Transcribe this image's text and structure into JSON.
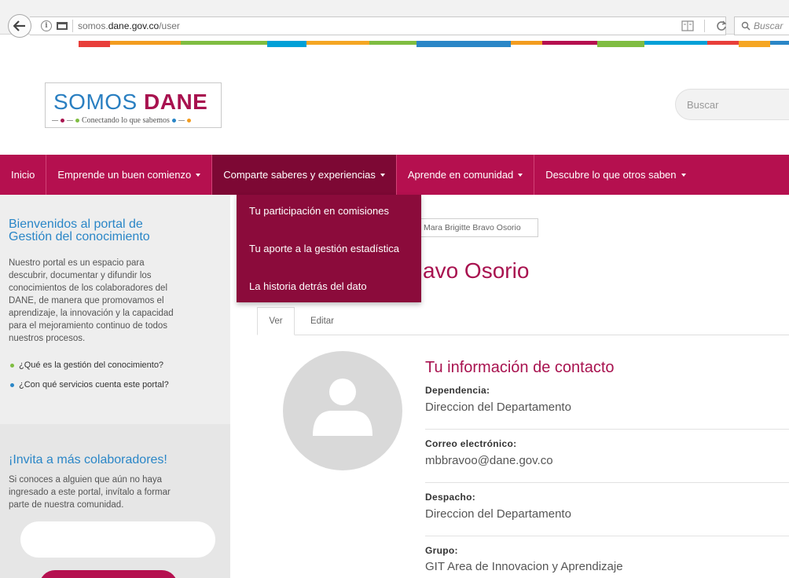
{
  "browser": {
    "url_prefix": "somos.",
    "url_domain": "dane.gov.co",
    "url_path": "/user",
    "search_placeholder": "Buscar"
  },
  "stripe_colors": [
    "#ffffff",
    "#e83e3a",
    "#f39c1f",
    "#7fbd41",
    "#00a0d7",
    "#f5a623",
    "#7fbd41",
    "#2a86c7",
    "#f39c1f",
    "#b5104f",
    "#7fbd41",
    "#00a0d7",
    "#e83e3a",
    "#f5a623",
    "#2a86c7"
  ],
  "logo": {
    "word1": "SOMOS",
    "word2": "DANE",
    "tagline": "Conectando lo que sabemos"
  },
  "site_search": {
    "placeholder": "Buscar"
  },
  "nav": {
    "items": [
      {
        "label": "Inicio",
        "caret": false
      },
      {
        "label": "Emprende un buen comienzo",
        "caret": true
      },
      {
        "label": "Comparte saberes y experiencias",
        "caret": true,
        "active": true
      },
      {
        "label": "Aprende en comunidad",
        "caret": true
      },
      {
        "label": "Descubre lo que otros saben",
        "caret": true
      }
    ]
  },
  "dropdown": {
    "items": [
      "Tu participación en comisiones",
      "Tu aporte a la gestión estadística",
      "La historia detrás del dato"
    ]
  },
  "sidebar": {
    "welcome_title_1": "Bienvenidos al portal de",
    "welcome_title_2": "Gestión del conocimiento",
    "welcome_text": [
      "Nuestro portal es un espacio para",
      "descubrir, documentar y difundir los",
      "conocimientos de los colaboradores del",
      "DANE, de manera que promovamos el",
      "aprendizaje, la innovación y la capacidad",
      "para el mejoramiento continuo de todos",
      "nuestros procesos."
    ],
    "links": [
      {
        "label": "¿Qué es la gestión del conocimiento?",
        "color": "#7fbd41"
      },
      {
        "label": "¿Con qué servicios cuenta este portal?",
        "color": "#2a86c7"
      }
    ],
    "invite_title": "¡Invita a más colaboradores!",
    "invite_text": [
      "Si conoces a alguien que aún no haya",
      "ingresado a este portal, invítalo a formar",
      "parte de nuestra comunidad."
    ]
  },
  "main": {
    "breadcrumb": "Mara Brigitte Bravo Osorio",
    "title_visible": "avo Osorio",
    "tabs": [
      "Ver",
      "Editar"
    ],
    "contact_title": "Tu información de contacto",
    "fields": [
      {
        "label": "Dependencia:",
        "value": "Direccion del Departamento"
      },
      {
        "label": "Correo electrónico:",
        "value": "mbbravoo@dane.gov.co"
      },
      {
        "label": "Despacho:",
        "value": "Direccion del Departamento"
      },
      {
        "label": "Grupo:",
        "value": "GIT Area de Innovacion y Aprendizaje"
      }
    ]
  }
}
